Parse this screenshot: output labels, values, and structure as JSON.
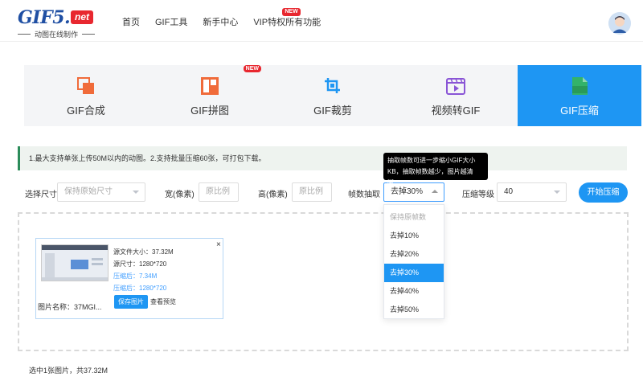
{
  "header": {
    "logo": {
      "word": "GIF5.",
      "net": "net",
      "sub": "动图在线制作"
    },
    "nav": [
      {
        "label": "首页"
      },
      {
        "label": "GIF工具"
      },
      {
        "label": "新手中心"
      },
      {
        "label": "VIP特权",
        "badge": "NEW"
      },
      {
        "label": "所有功能"
      }
    ]
  },
  "tools": [
    {
      "label": "GIF合成",
      "icon": "merge-icon"
    },
    {
      "label": "GIF拼图",
      "icon": "puzzle-icon",
      "badge": "NEW"
    },
    {
      "label": "GIF裁剪",
      "icon": "crop-icon"
    },
    {
      "label": "视频转GIF",
      "icon": "video-icon"
    },
    {
      "label": "GIF压缩",
      "icon": "zip-icon",
      "active": true,
      "icon_text": "ZIP"
    }
  ],
  "info": {
    "text": "1.最大支持单张上传50M以内的动图。2.支持批量压缩60张，可打包下载。",
    "tooltip": "抽取帧数可进一步缩小GIF大小KB，抽取帧数越少，图片越清晰。"
  },
  "options": {
    "size_label": "选择尺寸",
    "size_value": "保持原始尺寸",
    "width_label": "宽(像素)",
    "width_placeholder": "原比例",
    "height_label": "高(像素)",
    "height_placeholder": "原比例",
    "frame_label": "帧数抽取",
    "frame_value": "去掉30%",
    "level_label": "压缩等级",
    "level_value": "40",
    "start_button": "开始压缩"
  },
  "frame_options": [
    {
      "label": "保持原帧数",
      "disabled": true
    },
    {
      "label": "去掉10%"
    },
    {
      "label": "去掉20%"
    },
    {
      "label": "去掉30%",
      "selected": true
    },
    {
      "label": "去掉40%"
    },
    {
      "label": "去掉50%"
    }
  ],
  "file": {
    "close": "×",
    "source_size": "源文件大小：37.32M",
    "source_dim": "源尺寸：1280*720",
    "compressed_size": "压缩后：7.34M",
    "compressed_dim": "压缩后：1280*720",
    "name": "图片名称：37MGI...",
    "save_button": "保存图片",
    "preview": "查看预览"
  },
  "footer": {
    "summary": "选中1张图片，共37.32M"
  },
  "colors": {
    "accent": "#1e96f3",
    "brand_red": "#e8272f",
    "info_border": "#2c8c5a"
  }
}
